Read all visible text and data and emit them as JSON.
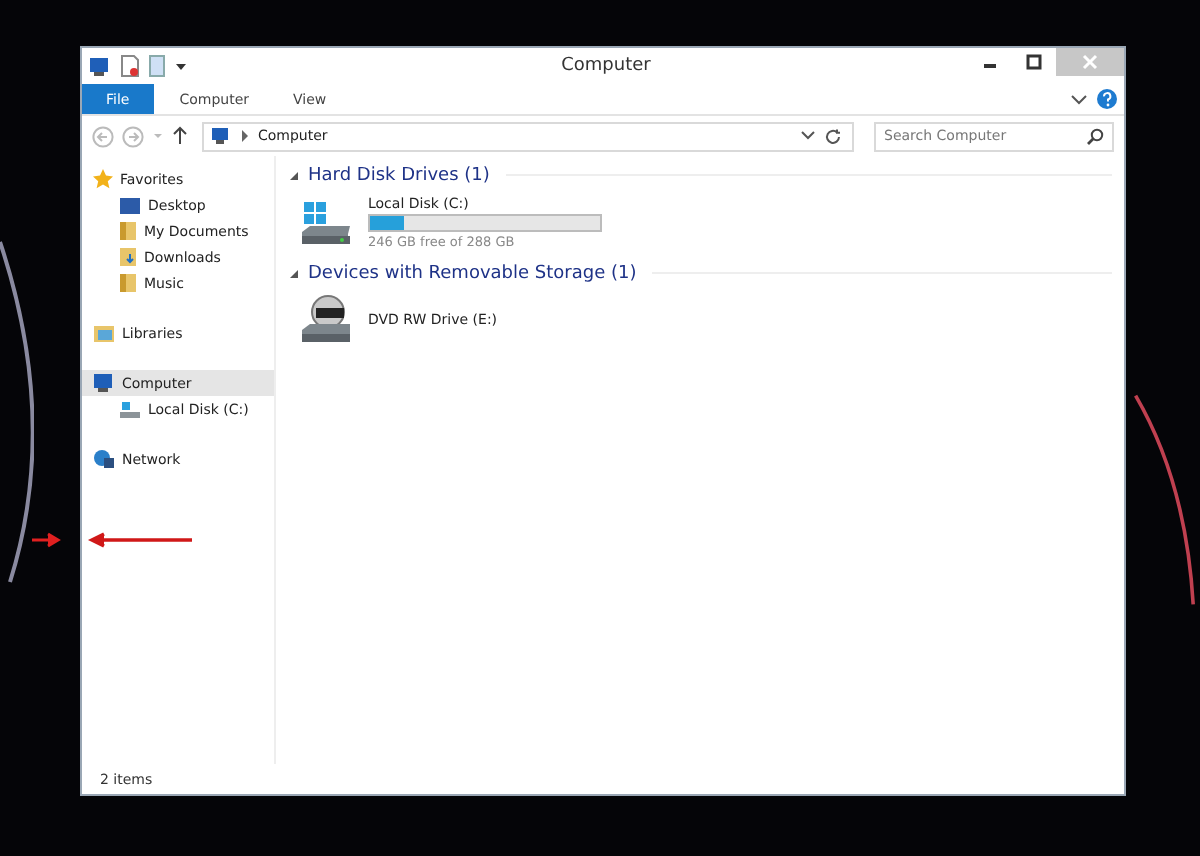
{
  "window": {
    "title": "Computer"
  },
  "ribbon_tabs": [
    {
      "label": "File",
      "kind": "file",
      "selected": false
    },
    {
      "label": "Computer",
      "kind": "tab",
      "selected": false
    },
    {
      "label": "View",
      "kind": "tab",
      "selected": false
    }
  ],
  "address_bar": {
    "crumb": "Computer"
  },
  "search": {
    "placeholder": "Search Computer"
  },
  "nav_pane": [
    {
      "label": "Favorites",
      "kind": "star",
      "selected": false,
      "children": [
        {
          "label": "Desktop",
          "kind": "desktop",
          "selected": false
        },
        {
          "label": "My Documents",
          "kind": "folder",
          "selected": false
        },
        {
          "label": "Downloads",
          "kind": "download",
          "selected": false
        },
        {
          "label": "Music",
          "kind": "folder",
          "selected": false
        }
      ]
    },
    {
      "label": "Libraries",
      "kind": "library",
      "selected": false
    },
    {
      "label": "Computer",
      "kind": "computer",
      "selected": true,
      "children": [
        {
          "label": "Local Disk (C:)",
          "kind": "drive",
          "selected": false
        }
      ]
    },
    {
      "label": "Network",
      "kind": "network",
      "selected": false
    }
  ],
  "groups": [
    {
      "title": "Hard Disk Drives (1)",
      "expanded": true,
      "items": [
        {
          "name": "Local Disk (C:)",
          "kind": "disk",
          "level": 0.15,
          "free": "246 GB free of 288 GB"
        }
      ]
    },
    {
      "title": "Devices with Removable Storage (1)",
      "expanded": true,
      "items": [
        {
          "name": "DVD RW Drive (E:)",
          "kind": "dvd"
        }
      ]
    }
  ],
  "status_bar": {
    "count": "2 items"
  }
}
